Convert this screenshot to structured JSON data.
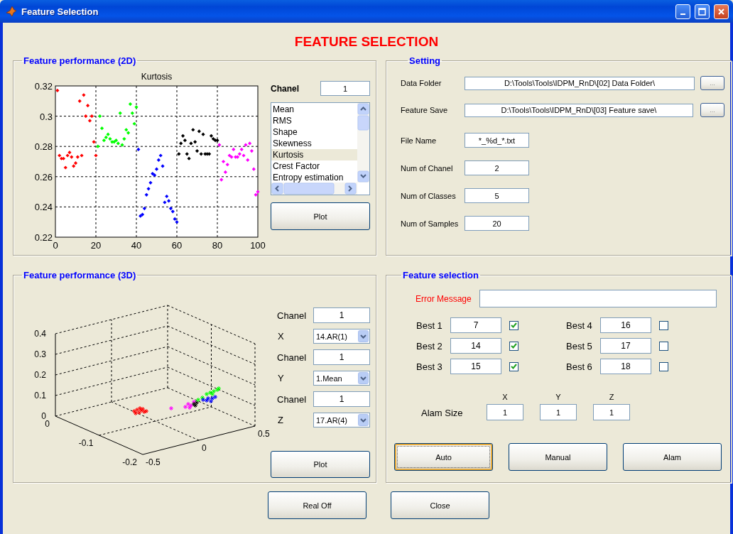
{
  "window": {
    "title": "Feature Selection"
  },
  "heading": "FEATURE SELECTION",
  "performance_2d": {
    "title": "Feature performance (2D)",
    "chart_data": {
      "type": "scatter",
      "title": "Kurtosis",
      "grid": true,
      "xlim": [
        0,
        100
      ],
      "ylim": [
        0.22,
        0.32
      ],
      "xticks": [
        0,
        20,
        40,
        60,
        80,
        100
      ],
      "yticks": [
        0.22,
        0.24,
        0.26,
        0.28,
        0.3,
        0.32
      ],
      "series": [
        {
          "color": "#ff0000",
          "x": [
            1,
            2,
            3,
            4,
            5,
            6,
            7,
            8,
            9,
            10,
            11,
            12,
            13,
            14,
            15,
            16,
            17,
            18,
            19,
            20
          ],
          "values": [
            0.317,
            0.274,
            0.272,
            0.272,
            0.266,
            0.274,
            0.276,
            0.273,
            0.267,
            0.269,
            0.273,
            0.31,
            0.274,
            0.314,
            0.3,
            0.307,
            0.297,
            0.3,
            0.283,
            0.274
          ]
        },
        {
          "color": "#00ff00",
          "x": [
            21,
            22,
            23,
            24,
            25,
            26,
            27,
            28,
            29,
            30,
            31,
            32,
            33,
            34,
            35,
            36,
            37,
            38,
            39,
            40
          ],
          "values": [
            0.28,
            0.3,
            0.292,
            0.284,
            0.286,
            0.288,
            0.285,
            0.283,
            0.283,
            0.284,
            0.282,
            0.302,
            0.281,
            0.285,
            0.291,
            0.289,
            0.308,
            0.302,
            0.295,
            0.306
          ]
        },
        {
          "color": "#0000ff",
          "x": [
            41,
            42,
            43,
            44,
            45,
            46,
            47,
            48,
            49,
            50,
            51,
            52,
            53,
            54,
            55,
            56,
            57,
            58,
            59,
            60
          ],
          "values": [
            0.278,
            0.234,
            0.235,
            0.239,
            0.248,
            0.252,
            0.256,
            0.262,
            0.261,
            0.265,
            0.271,
            0.274,
            0.267,
            0.243,
            0.247,
            0.244,
            0.239,
            0.237,
            0.232,
            0.23
          ]
        },
        {
          "color": "#000000",
          "x": [
            61,
            62,
            63,
            64,
            65,
            66,
            67,
            68,
            69,
            70,
            71,
            72,
            73,
            74,
            75,
            76,
            77,
            78,
            79,
            80
          ],
          "values": [
            0.275,
            0.282,
            0.287,
            0.284,
            0.275,
            0.272,
            0.282,
            0.291,
            0.283,
            0.277,
            0.29,
            0.275,
            0.288,
            0.275,
            0.275,
            0.275,
            0.287,
            0.285,
            0.284,
            0.284
          ]
        },
        {
          "color": "#ff00ff",
          "x": [
            81,
            82,
            83,
            84,
            85,
            86,
            87,
            88,
            89,
            90,
            91,
            92,
            93,
            94,
            95,
            96,
            97,
            98,
            99,
            100
          ],
          "values": [
            0.281,
            0.258,
            0.27,
            0.263,
            0.268,
            0.274,
            0.273,
            0.278,
            0.273,
            0.273,
            0.275,
            0.278,
            0.274,
            0.281,
            0.271,
            0.282,
            0.277,
            0.265,
            0.248,
            0.25
          ]
        }
      ]
    },
    "chanel_label": "Chanel",
    "chanel_value": "1",
    "features": [
      {
        "label": "Mean",
        "selected": false
      },
      {
        "label": "RMS",
        "selected": false
      },
      {
        "label": "Shape",
        "selected": false
      },
      {
        "label": "Skewness",
        "selected": false
      },
      {
        "label": "Kurtosis",
        "selected": true
      },
      {
        "label": "Crest Factor",
        "selected": false
      },
      {
        "label": "Entropy estimation",
        "selected": false
      }
    ],
    "plot_button": "Plot"
  },
  "performance_3d": {
    "title": "Feature performance (3D)",
    "z_ticks": [
      "0.4",
      "0.3",
      "0.2",
      "0.1",
      "0"
    ],
    "y_ticks": [
      "0",
      "-0.1",
      "-0.2"
    ],
    "x_ticks": [
      "-0.5",
      "0",
      "0.5"
    ],
    "axes": [
      {
        "chanel_label": "Chanel",
        "chanel_value": "1",
        "axis_label": "X",
        "feature": "14.AR(1)"
      },
      {
        "chanel_label": "Chanel",
        "chanel_value": "1",
        "axis_label": "Y",
        "feature": "1.Mean"
      },
      {
        "chanel_label": "Chanel",
        "chanel_value": "1",
        "axis_label": "Z",
        "feature": "17.AR(4)"
      }
    ],
    "plot_button": "Plot"
  },
  "setting": {
    "title": "Setting",
    "paths": [
      {
        "label": "Data Folder",
        "value": "D:\\Tools\\Tools\\IDPM_RnD\\[02] Data Folder\\",
        "browse": "..."
      },
      {
        "label": "Feature Save",
        "value": "D:\\Tools\\Tools\\IDPM_RnD\\[03] Feature save\\",
        "browse": "..."
      }
    ],
    "fields": [
      {
        "label": "File Name",
        "value": "*_%d_*.txt"
      },
      {
        "label": "Num of Chanel",
        "value": "2"
      },
      {
        "label": "Num of Classes",
        "value": "5"
      },
      {
        "label": "Num of Samples",
        "value": "20"
      }
    ]
  },
  "feature_selection": {
    "title": "Feature selection",
    "error_label": "Error Message",
    "best": [
      {
        "label": "Best 1",
        "value": "7",
        "checked": true
      },
      {
        "label": "Best 2",
        "value": "14",
        "checked": true
      },
      {
        "label": "Best 3",
        "value": "15",
        "checked": true
      },
      {
        "label": "Best 4",
        "value": "16",
        "checked": false
      },
      {
        "label": "Best 5",
        "value": "17",
        "checked": false
      },
      {
        "label": "Best 6",
        "value": "18",
        "checked": false
      }
    ],
    "alarm_size": {
      "label": "Alam Size",
      "axes": [
        {
          "axis": "X",
          "value": "1"
        },
        {
          "axis": "Y",
          "value": "1"
        },
        {
          "axis": "Z",
          "value": "1"
        }
      ]
    },
    "buttons": [
      {
        "label": "Auto",
        "focused": true
      },
      {
        "label": "Manual",
        "focused": false
      },
      {
        "label": "Alam",
        "focused": false
      }
    ]
  },
  "buttons": [
    "Real Off",
    "Close"
  ]
}
